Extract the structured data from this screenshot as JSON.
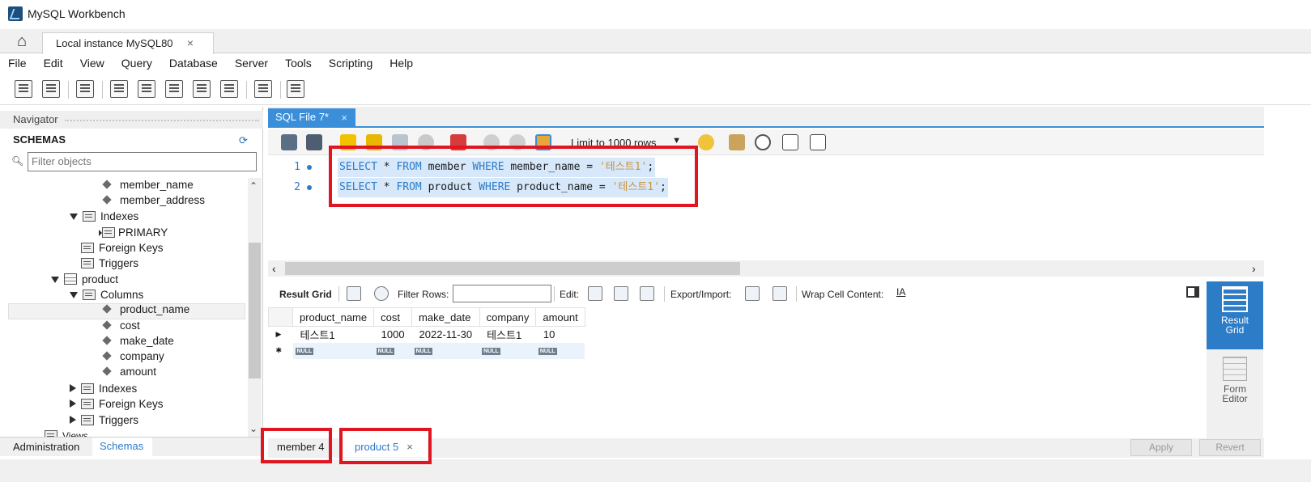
{
  "window": {
    "title": "MySQL Workbench"
  },
  "connection_tab": {
    "label": "Local instance MySQL80",
    "close": "×"
  },
  "menu": [
    "File",
    "Edit",
    "View",
    "Query",
    "Database",
    "Server",
    "Tools",
    "Scripting",
    "Help"
  ],
  "navigator": {
    "header": "Navigator",
    "schemas_label": "SCHEMAS",
    "filter_placeholder": "Filter objects",
    "tree": {
      "member_name": "member_name",
      "member_address": "member_address",
      "indexes1": "Indexes",
      "primary": "PRIMARY",
      "foreign_keys1": "Foreign Keys",
      "triggers1": "Triggers",
      "product": "product",
      "columns": "Columns",
      "col_product_name": "product_name",
      "col_cost": "cost",
      "col_make_date": "make_date",
      "col_company": "company",
      "col_amount": "amount",
      "indexes2": "Indexes",
      "foreign_keys2": "Foreign Keys",
      "triggers2": "Triggers",
      "views": "Views"
    },
    "bottom_tabs": {
      "administration": "Administration",
      "schemas": "Schemas"
    }
  },
  "sql_tab": {
    "label": "SQL File 7*",
    "close": "×"
  },
  "limit_select": "Limit to 1000 rows",
  "editor": {
    "line1_num": "1",
    "line2_num": "2",
    "line1": {
      "kw1": "SELECT",
      "t1": " * ",
      "kw2": "FROM",
      "t2": " member ",
      "kw3": "WHERE",
      "t3": " member_name = ",
      "s": "'테스트1'",
      "end": ";"
    },
    "line2": {
      "kw1": "SELECT",
      "t1": " * ",
      "kw2": "FROM",
      "t2": " product ",
      "kw3": "WHERE",
      "t3": " product_name = ",
      "s": "'테스트1'",
      "end": ";"
    }
  },
  "result_toolbar": {
    "result_grid": "Result Grid",
    "filter_rows": "Filter Rows:",
    "edit": "Edit:",
    "export_import": "Export/Import:",
    "wrap": "Wrap Cell Content:"
  },
  "grid": {
    "columns": [
      "product_name",
      "cost",
      "make_date",
      "company",
      "amount"
    ],
    "row": [
      "테스트1",
      "1000",
      "2022-11-30",
      "테스트1",
      "10"
    ],
    "null_label": "NULL"
  },
  "side_panel": {
    "result_grid": [
      "Result",
      "Grid"
    ],
    "form_editor": [
      "Form",
      "Editor"
    ]
  },
  "result_tabs": {
    "member": "member 4",
    "product": "product 5",
    "close": "×"
  },
  "buttons": {
    "apply": "Apply",
    "revert": "Revert"
  },
  "colors": {
    "accent": "#2c7cc8",
    "highlight_box": "#e0151f",
    "selection": "#d7e8fb"
  }
}
